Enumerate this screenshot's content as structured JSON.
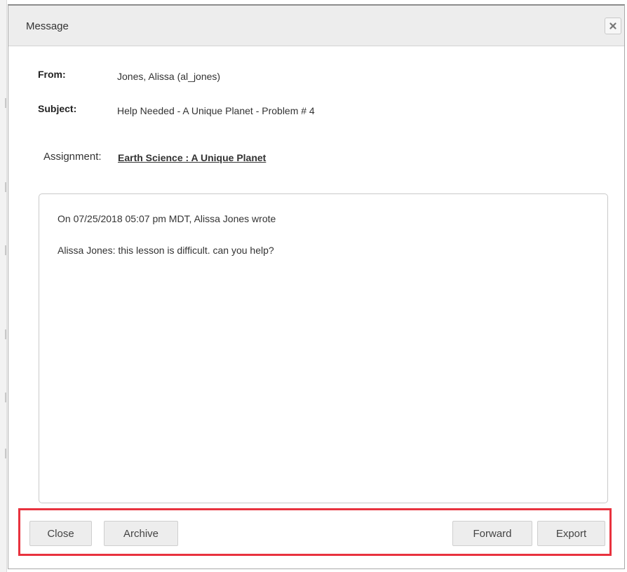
{
  "dialog": {
    "title": "Message",
    "close_icon": "close-x-icon"
  },
  "meta": {
    "from_label": "From:",
    "from_value": "Jones, Alissa (al_jones)",
    "subject_label": "Subject:",
    "subject_value": "Help Needed - A Unique Planet - Problem # 4",
    "assignment_label": "Assignment:",
    "assignment_link": "Earth Science : A Unique Planet"
  },
  "message": {
    "header_line": "On 07/25/2018 05:07 pm MDT, Alissa Jones wrote",
    "body_line": "Alissa Jones: this lesson is difficult. can you help?"
  },
  "footer": {
    "close_label": "Close",
    "archive_label": "Archive",
    "forward_label": "Forward",
    "export_label": "Export",
    "highlight_color": "#e8323e"
  }
}
